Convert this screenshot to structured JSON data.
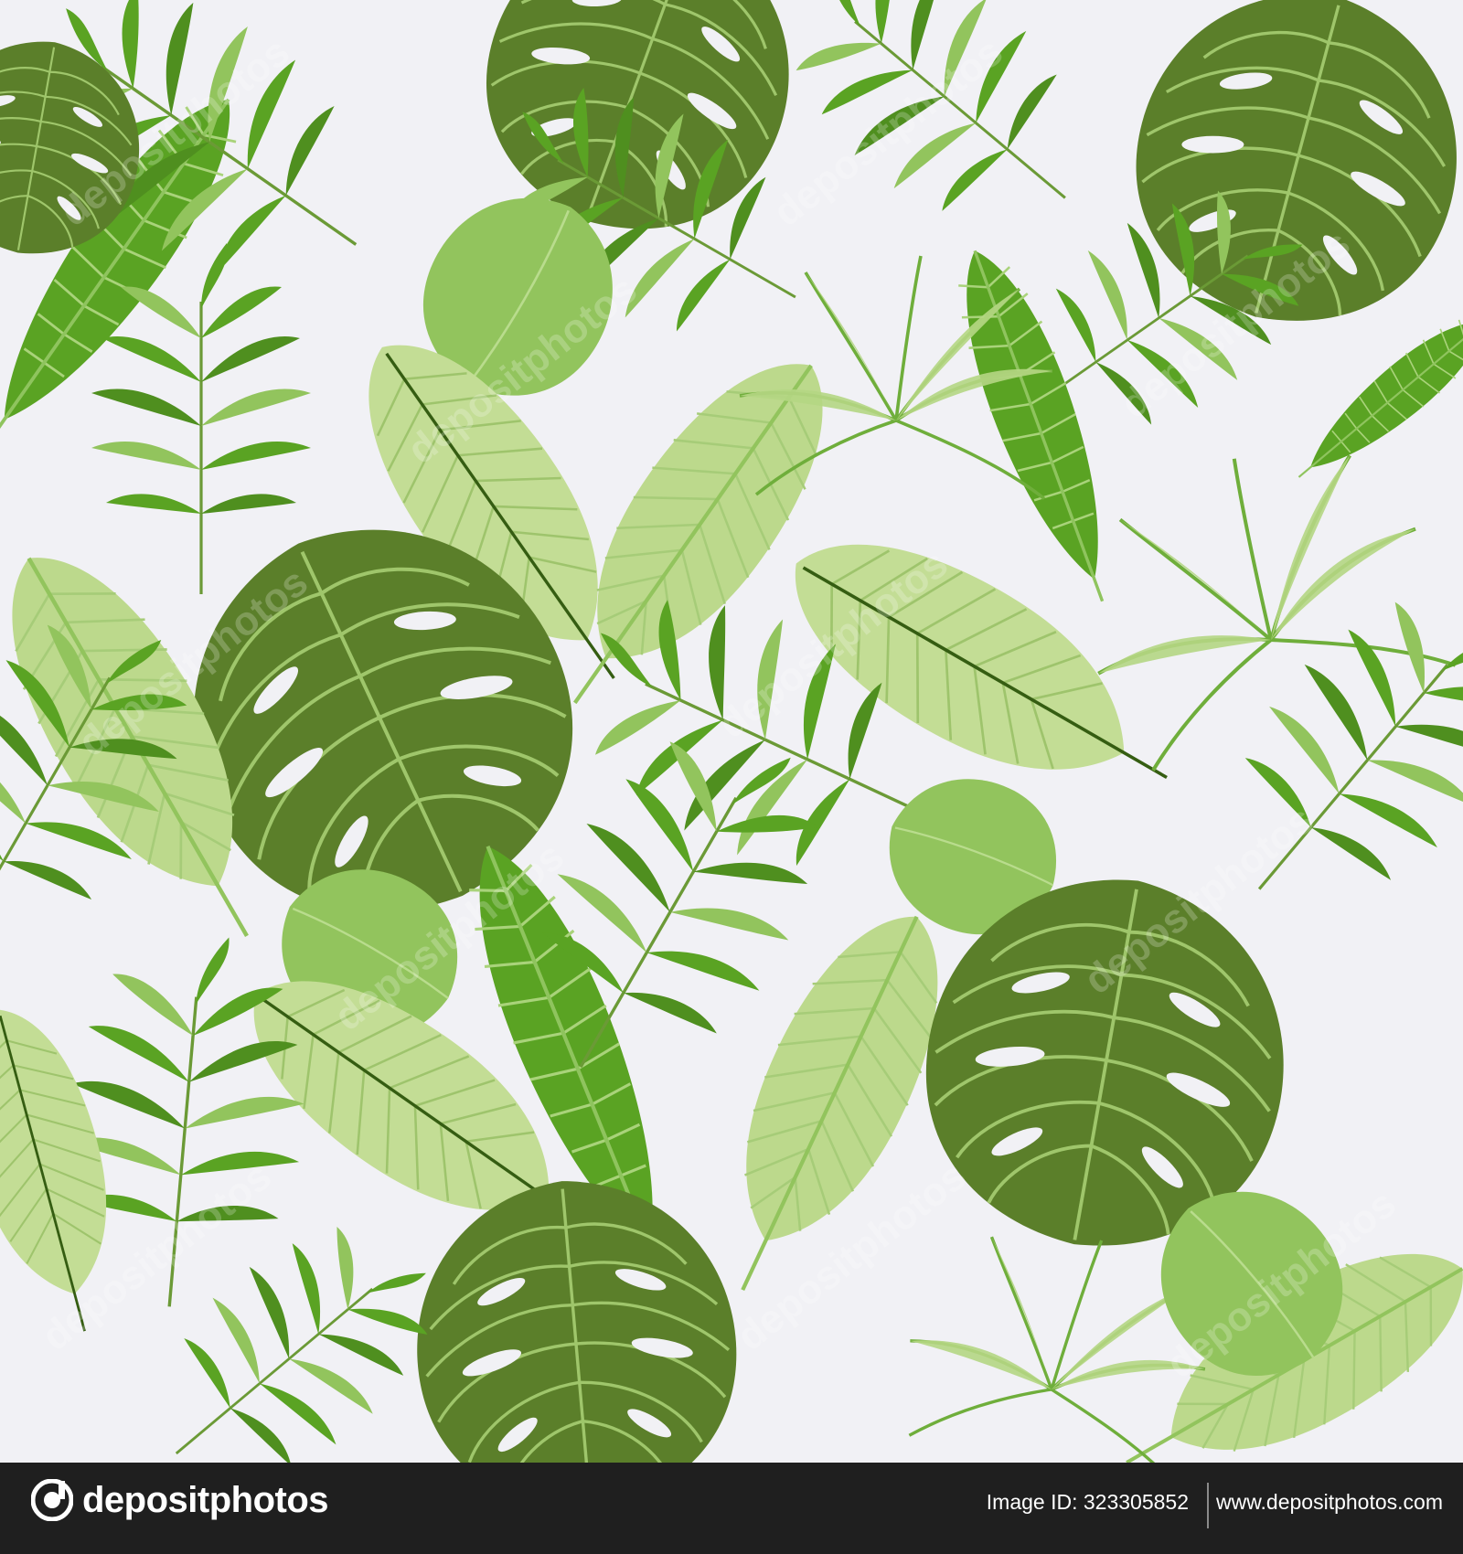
{
  "image": {
    "description_type": "seamless tropical leaf pattern",
    "background_color": "#f1f1f5",
    "palette": {
      "dark_green": "#5b7f2a",
      "mid_green": "#5aa323",
      "light_green": "#92c45d",
      "pale_green": "#bcd98c",
      "vein_light": "#d6e9b4",
      "stem_dark": "#355d12"
    }
  },
  "watermark": {
    "text": "depositphotos",
    "positions_note": "diagonal repeated watermark"
  },
  "footer": {
    "logo_text": "depositphotos",
    "image_id_label": "Image ID: 323305852",
    "site_url": "www.depositphotos.com",
    "background_color": "#1f1f1f"
  },
  "icons": {
    "logo": "depositphotos-logo-icon"
  }
}
